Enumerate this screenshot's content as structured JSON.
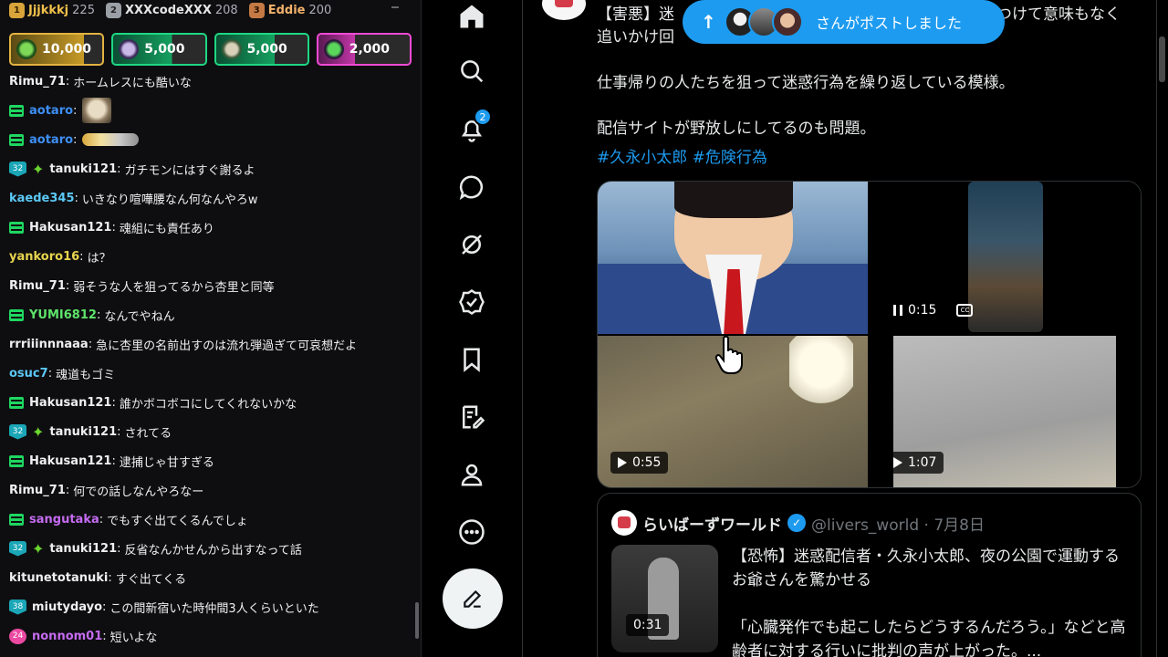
{
  "leaderboard": [
    {
      "rank": "1",
      "name": "Jjjkkkj",
      "points": "225"
    },
    {
      "rank": "2",
      "name": "XXXcodeXXX",
      "points": "208"
    },
    {
      "rank": "3",
      "name": "Eddie",
      "points": "200"
    }
  ],
  "gifts": [
    {
      "amount": "10,000",
      "color": "#e3b341"
    },
    {
      "amount": "5,000",
      "color": "#1ed783"
    },
    {
      "amount": "5,000",
      "color": "#1ed783"
    },
    {
      "amount": "2,000",
      "color": "#f14ad5"
    }
  ],
  "chat": [
    {
      "user": "Rimu_71",
      "color": "#efeff1",
      "text": "ホームレスにも酷いな"
    },
    {
      "user": "aotaro",
      "color": "#3d8ff5",
      "text": ""
    },
    {
      "user": "aotaro",
      "color": "#3d8ff5",
      "text": ""
    },
    {
      "user": "tanuki121",
      "color": "#efeff1",
      "level": "32",
      "text": "ガチモンにはすぐ謝るよ"
    },
    {
      "user": "kaede345",
      "color": "#5bc8f5",
      "text": "いきなり喧嘩腰なん何なんやろw"
    },
    {
      "user": "Hakusan121",
      "color": "#efeff1",
      "text": "魂組にも責任あり"
    },
    {
      "user": "yankoro16",
      "color": "#e8d44d",
      "text": "は？"
    },
    {
      "user": "Rimu_71",
      "color": "#efeff1",
      "text": "弱そうな人を狙ってるから杏里と同等"
    },
    {
      "user": "YUMI6812",
      "color": "#5ee36a",
      "text": "なんでやねん"
    },
    {
      "user": "rrriiinnnaaa",
      "color": "#efeff1",
      "text": "急に杏里の名前出すのは流れ弾過ぎて可哀想だよ"
    },
    {
      "user": "osuc7",
      "color": "#5bc8f5",
      "text": "魂道もゴミ"
    },
    {
      "user": "Hakusan121",
      "color": "#efeff1",
      "text": "誰かボコボコにしてくれないかな"
    },
    {
      "user": "tanuki121",
      "color": "#efeff1",
      "level": "32",
      "text": "されてる"
    },
    {
      "user": "Hakusan121",
      "color": "#efeff1",
      "text": "逮捕じゃ甘すぎる"
    },
    {
      "user": "Rimu_71",
      "color": "#efeff1",
      "text": "何での話しなんやろなー"
    },
    {
      "user": "sangutaka",
      "color": "#c46bf0",
      "text": "でもすぐ出てくるんでしょ"
    },
    {
      "user": "tanuki121",
      "color": "#efeff1",
      "level": "32",
      "text": "反省なんかせんから出すなって話"
    },
    {
      "user": "kitunetotanuki",
      "color": "#efeff1",
      "text": "すぐ出てくる"
    },
    {
      "user": "miutydayo",
      "color": "#efeff1",
      "level": "38",
      "text": "この間新宿いた時仲間3人くらいといた"
    },
    {
      "user": "nonnom01",
      "color": "#c46bf0",
      "level": "24",
      "text": "短いよな"
    }
  ],
  "nav": {
    "notification_count": "2"
  },
  "pill": {
    "text": "さんがポストしました"
  },
  "tweet": {
    "line1": "【害悪】迷",
    "line1_tail": "つけて意味もなく",
    "line2": "追いかけ回",
    "para2": "仕事帰りの人たちを狙って迷惑行為を繰り返している模様。",
    "para3": "配信サイトが野放しにしてるのも問題。",
    "hashtags": "#久永小太郎 #危険行為",
    "media_durations": [
      "0:15",
      "0:55",
      "1:07"
    ]
  },
  "quote": {
    "name": "らいばーずワールド",
    "handle": "@livers_world · 7月8日",
    "para1": "【恐怖】迷惑配信者・久永小太郎、夜の公園で運動するお爺さんを驚かせる",
    "para2": "「心臓発作でも起こしたらどうするんだろう。」などと高齢者に対する行いに批判の声が上がった。...",
    "thumb_duration": "0:31"
  }
}
